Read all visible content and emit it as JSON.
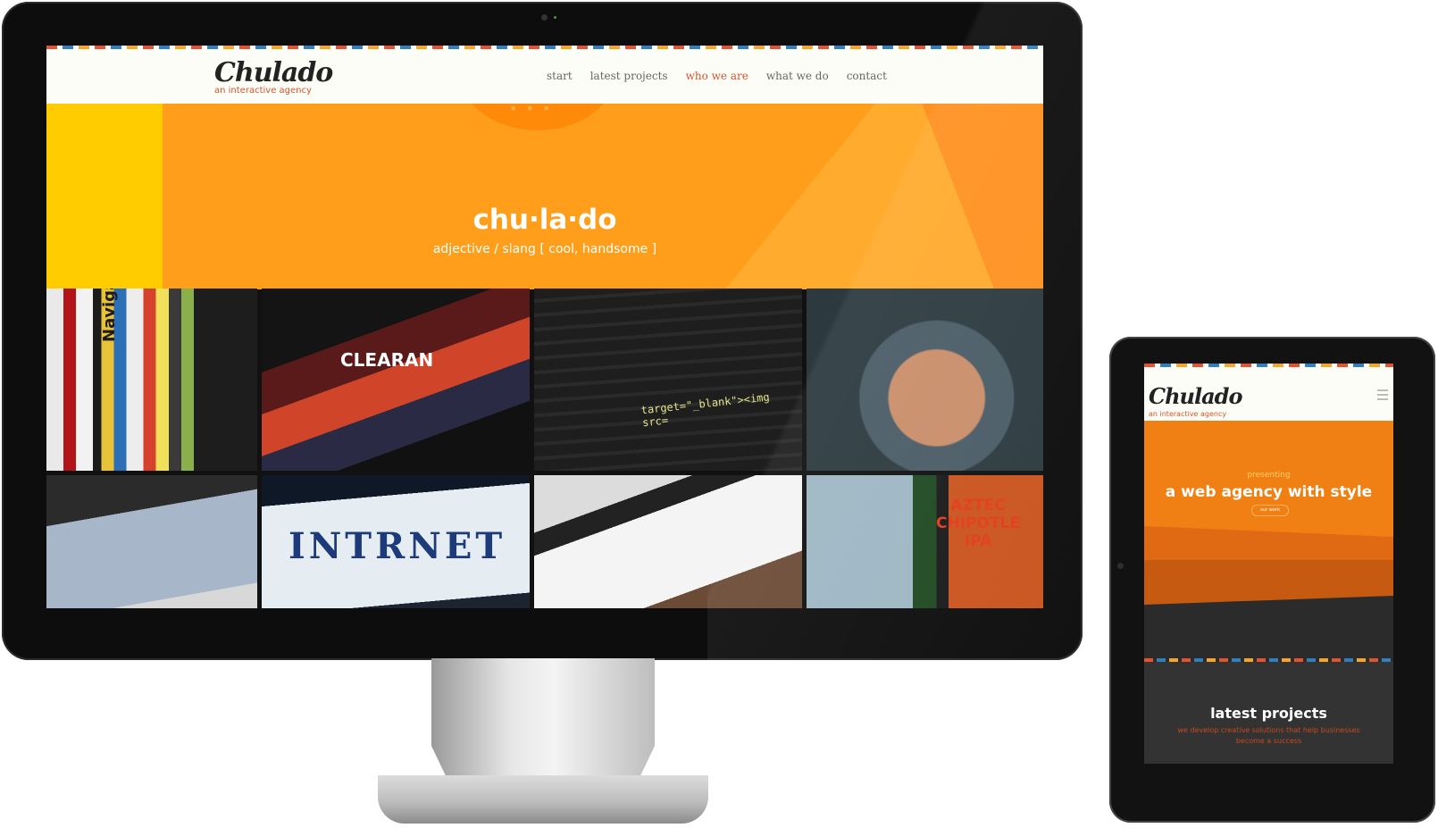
{
  "brand": {
    "name": "Chulado",
    "tagline": "an interactive agency"
  },
  "nav": {
    "items": [
      {
        "label": "start"
      },
      {
        "label": "latest projects"
      },
      {
        "label": "who we are",
        "active": true
      },
      {
        "label": "what we do"
      },
      {
        "label": "contact"
      }
    ]
  },
  "hero": {
    "title": "chu·la·do",
    "subtitle": "adjective / slang [ cool, handsome ]"
  },
  "gallery": {
    "tiles": [
      {
        "caption": "Navigator"
      },
      {
        "caption": "CLEARAN"
      },
      {
        "caption": "target=\"_blank\"><img src="
      },
      {
        "caption": ""
      },
      {
        "caption": ""
      },
      {
        "caption": "INTRNET"
      },
      {
        "caption": ""
      },
      {
        "caption": "AZTEC CHIPOTLE IPA"
      }
    ]
  },
  "tablet": {
    "presenting": "presenting",
    "title": "a web agency with style",
    "button": "our work",
    "latest_title": "latest projects",
    "latest_desc": "we develop creative solutions that help businesses become a success"
  },
  "colors": {
    "accent": "#d9532b",
    "hero_orange": "#ff9e1a",
    "hero_yellow": "#ffcc00",
    "tablet_orange": "#f08014"
  }
}
